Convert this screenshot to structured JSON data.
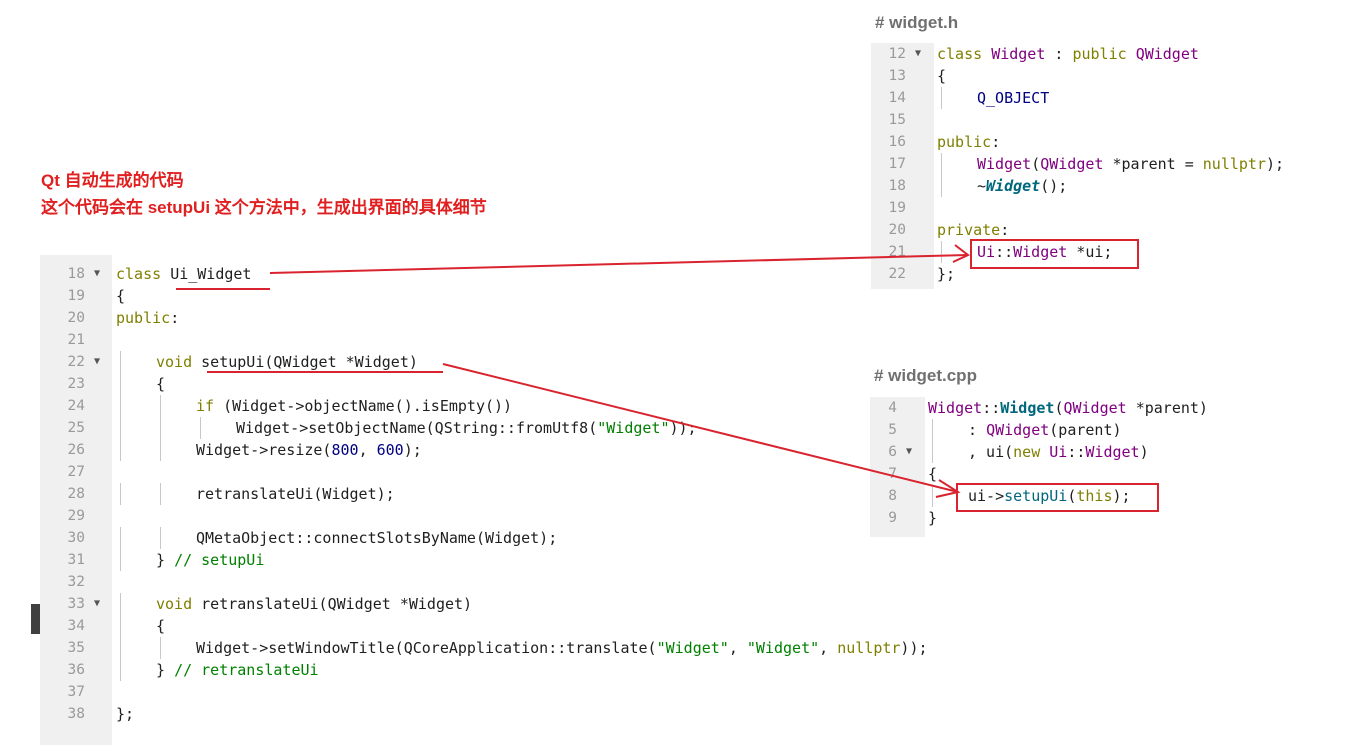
{
  "notes": {
    "line1": "Qt 自动生成的代码",
    "line2": "这个代码会在 setupUi 这个方法中，生成出界面的具体细节"
  },
  "widget_h": {
    "title": "# widget.h",
    "lines": [
      {
        "n": "12",
        "fold": true,
        "indent": 0,
        "tokens": [
          {
            "t": "class ",
            "c": "kw"
          },
          {
            "t": "Widget",
            "c": "cls"
          },
          {
            "t": " : ",
            "c": ""
          },
          {
            "t": "public ",
            "c": "kw"
          },
          {
            "t": "QWidget",
            "c": "cls"
          }
        ]
      },
      {
        "n": "13",
        "fold": false,
        "indent": 0,
        "tokens": [
          {
            "t": "{",
            "c": ""
          }
        ]
      },
      {
        "n": "14",
        "fold": false,
        "indent": 1,
        "tokens": [
          {
            "t": "Q_OBJECT",
            "c": "mac"
          }
        ]
      },
      {
        "n": "15",
        "fold": false,
        "indent": 0,
        "tokens": []
      },
      {
        "n": "16",
        "fold": false,
        "indent": 0,
        "tokens": [
          {
            "t": "public",
            "c": "kw"
          },
          {
            "t": ":",
            "c": ""
          }
        ]
      },
      {
        "n": "17",
        "fold": false,
        "indent": 1,
        "tokens": [
          {
            "t": "Widget",
            "c": "cls"
          },
          {
            "t": "(",
            "c": ""
          },
          {
            "t": "QWidget",
            "c": "cls"
          },
          {
            "t": " *parent = ",
            "c": ""
          },
          {
            "t": "nullptr",
            "c": "kw"
          },
          {
            "t": ");",
            "c": ""
          }
        ]
      },
      {
        "n": "18",
        "fold": false,
        "indent": 1,
        "tokens": [
          {
            "t": "~",
            "c": ""
          },
          {
            "t": "Widget",
            "c": "fni"
          },
          {
            "t": "();",
            "c": ""
          }
        ]
      },
      {
        "n": "19",
        "fold": false,
        "indent": 0,
        "tokens": []
      },
      {
        "n": "20",
        "fold": false,
        "indent": 0,
        "tokens": [
          {
            "t": "private",
            "c": "kw"
          },
          {
            "t": ":",
            "c": ""
          }
        ]
      },
      {
        "n": "21",
        "fold": false,
        "indent": 1,
        "tokens": [
          {
            "t": "Ui",
            "c": "cls"
          },
          {
            "t": "::",
            "c": ""
          },
          {
            "t": "Widget",
            "c": "cls"
          },
          {
            "t": " *ui;",
            "c": ""
          }
        ]
      },
      {
        "n": "22",
        "fold": false,
        "indent": 0,
        "tokens": [
          {
            "t": "};",
            "c": ""
          }
        ]
      }
    ]
  },
  "widget_cpp": {
    "title": "# widget.cpp",
    "lines": [
      {
        "n": "4",
        "fold": false,
        "indent": 0,
        "tokens": [
          {
            "t": "Widget",
            "c": "cls"
          },
          {
            "t": "::",
            "c": ""
          },
          {
            "t": "Widget",
            "c": "fnb"
          },
          {
            "t": "(",
            "c": ""
          },
          {
            "t": "QWidget",
            "c": "cls"
          },
          {
            "t": " *parent)",
            "c": ""
          }
        ]
      },
      {
        "n": "5",
        "fold": false,
        "indent": 1,
        "tokens": [
          {
            "t": ": ",
            "c": ""
          },
          {
            "t": "QWidget",
            "c": "cls"
          },
          {
            "t": "(parent)",
            "c": ""
          }
        ]
      },
      {
        "n": "6",
        "fold": true,
        "indent": 1,
        "tokens": [
          {
            "t": ", ui(",
            "c": ""
          },
          {
            "t": "new ",
            "c": "kw"
          },
          {
            "t": "Ui",
            "c": "cls"
          },
          {
            "t": "::",
            "c": ""
          },
          {
            "t": "Widget",
            "c": "cls"
          },
          {
            "t": ")",
            "c": ""
          }
        ]
      },
      {
        "n": "7",
        "fold": false,
        "indent": 0,
        "tokens": [
          {
            "t": "{",
            "c": ""
          }
        ]
      },
      {
        "n": "8",
        "fold": false,
        "indent": 1,
        "tokens": [
          {
            "t": "ui->",
            "c": ""
          },
          {
            "t": "setupUi",
            "c": "fn"
          },
          {
            "t": "(",
            "c": ""
          },
          {
            "t": "this",
            "c": "kw"
          },
          {
            "t": ");",
            "c": ""
          }
        ]
      },
      {
        "n": "9",
        "fold": false,
        "indent": 0,
        "tokens": [
          {
            "t": "}",
            "c": ""
          }
        ]
      }
    ]
  },
  "ui_widget": {
    "lines": [
      {
        "n": "18",
        "fold": true,
        "indent": 0,
        "tokens": [
          {
            "t": "class ",
            "c": "kw"
          },
          {
            "t": "Ui_Widget",
            "c": ""
          }
        ]
      },
      {
        "n": "19",
        "fold": false,
        "indent": 0,
        "tokens": [
          {
            "t": "{",
            "c": ""
          }
        ]
      },
      {
        "n": "20",
        "fold": false,
        "indent": 0,
        "tokens": [
          {
            "t": "public",
            "c": "kw"
          },
          {
            "t": ":",
            "c": ""
          }
        ]
      },
      {
        "n": "21",
        "fold": false,
        "indent": 0,
        "tokens": []
      },
      {
        "n": "22",
        "fold": true,
        "indent": 1,
        "tokens": [
          {
            "t": "void ",
            "c": "kw"
          },
          {
            "t": "setupUi",
            "c": ""
          },
          {
            "t": "(",
            "c": ""
          },
          {
            "t": "QWidget",
            "c": ""
          },
          {
            "t": " *Widget)",
            "c": ""
          }
        ]
      },
      {
        "n": "23",
        "fold": false,
        "indent": 1,
        "tokens": [
          {
            "t": "{",
            "c": ""
          }
        ]
      },
      {
        "n": "24",
        "fold": false,
        "indent": 2,
        "tokens": [
          {
            "t": "if ",
            "c": "kw"
          },
          {
            "t": "(Widget->objectName().isEmpty())",
            "c": ""
          }
        ]
      },
      {
        "n": "25",
        "fold": false,
        "indent": 3,
        "tokens": [
          {
            "t": "Widget->setObjectName(QString::fromUtf8(",
            "c": ""
          },
          {
            "t": "\"Widget\"",
            "c": "str"
          },
          {
            "t": "));",
            "c": ""
          }
        ]
      },
      {
        "n": "26",
        "fold": false,
        "indent": 2,
        "tokens": [
          {
            "t": "Widget->resize(",
            "c": ""
          },
          {
            "t": "800",
            "c": "num"
          },
          {
            "t": ", ",
            "c": ""
          },
          {
            "t": "600",
            "c": "num"
          },
          {
            "t": ");",
            "c": ""
          }
        ]
      },
      {
        "n": "27",
        "fold": false,
        "indent": 0,
        "tokens": []
      },
      {
        "n": "28",
        "fold": false,
        "indent": 2,
        "tokens": [
          {
            "t": "retranslateUi(Widget);",
            "c": ""
          }
        ]
      },
      {
        "n": "29",
        "fold": false,
        "indent": 0,
        "tokens": []
      },
      {
        "n": "30",
        "fold": false,
        "indent": 2,
        "tokens": [
          {
            "t": "QMetaObject::connectSlotsByName(Widget);",
            "c": ""
          }
        ]
      },
      {
        "n": "31",
        "fold": false,
        "indent": 1,
        "tokens": [
          {
            "t": "} ",
            "c": ""
          },
          {
            "t": "// setupUi",
            "c": "cm"
          }
        ]
      },
      {
        "n": "32",
        "fold": false,
        "indent": 0,
        "tokens": []
      },
      {
        "n": "33",
        "fold": true,
        "indent": 1,
        "tokens": [
          {
            "t": "void ",
            "c": "kw"
          },
          {
            "t": "retranslateUi(QWidget *Widget)",
            "c": ""
          }
        ]
      },
      {
        "n": "34",
        "fold": false,
        "indent": 1,
        "tokens": [
          {
            "t": "{",
            "c": ""
          }
        ]
      },
      {
        "n": "35",
        "fold": false,
        "indent": 2,
        "tokens": [
          {
            "t": "Widget->setWindowTitle(QCoreApplication::translate(",
            "c": ""
          },
          {
            "t": "\"Widget\"",
            "c": "str"
          },
          {
            "t": ", ",
            "c": ""
          },
          {
            "t": "\"Widget\"",
            "c": "str"
          },
          {
            "t": ", ",
            "c": ""
          },
          {
            "t": "nullptr",
            "c": "kw"
          },
          {
            "t": "));",
            "c": ""
          }
        ]
      },
      {
        "n": "36",
        "fold": false,
        "indent": 1,
        "tokens": [
          {
            "t": "} ",
            "c": ""
          },
          {
            "t": "// retranslateUi",
            "c": "cm"
          }
        ]
      },
      {
        "n": "37",
        "fold": false,
        "indent": 0,
        "tokens": []
      },
      {
        "n": "38",
        "fold": false,
        "indent": 0,
        "tokens": [
          {
            "t": "};",
            "c": ""
          }
        ]
      }
    ]
  },
  "colors": {
    "accent_red": "#d9232e",
    "gutter_bg": "#f0f0f0"
  }
}
